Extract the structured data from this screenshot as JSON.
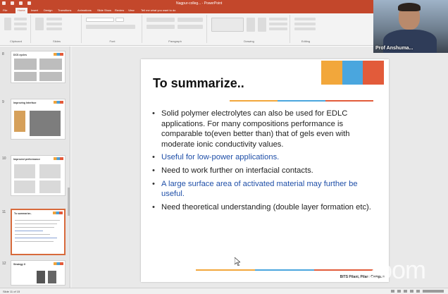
{
  "window": {
    "title": "Nagpur-colleg...  - PowerPoint"
  },
  "ribbon": {
    "tabs": [
      {
        "label": "File"
      },
      {
        "label": "Home"
      },
      {
        "label": "Insert"
      },
      {
        "label": "Design"
      },
      {
        "label": "Transitions"
      },
      {
        "label": "Animations"
      },
      {
        "label": "Slide Show"
      },
      {
        "label": "Review"
      },
      {
        "label": "View"
      },
      {
        "label": "Tell me what you want to do"
      }
    ],
    "active_tab": "Home",
    "groups": [
      {
        "label": "Clipboard"
      },
      {
        "label": "Slides"
      },
      {
        "label": "Font"
      },
      {
        "label": "Paragraph"
      },
      {
        "label": "Drawing"
      },
      {
        "label": "Editing"
      }
    ]
  },
  "thumbnails": [
    {
      "num": "8",
      "title": "DCS cycles",
      "selected": false
    },
    {
      "num": "9",
      "title": "Improving Interface",
      "selected": false
    },
    {
      "num": "10",
      "title": "Improved performance",
      "selected": false
    },
    {
      "num": "11",
      "title": "To summarize..",
      "selected": true
    },
    {
      "num": "12",
      "title": "Strategy II",
      "selected": false
    }
  ],
  "slide": {
    "title": "To summarize..",
    "bullets": [
      {
        "text": "Solid polymer electrolytes can also be used for EDLC applications. For many compositions performance is comparable to(even better than) that of gels even with moderate ionic conductivity values.",
        "style": "normal"
      },
      {
        "text": "Useful for low-power applications.",
        "style": "blue"
      },
      {
        "text": "Need to work further on interfacial contacts.",
        "style": "normal"
      },
      {
        "text": "A large surface area of activated material may further be useful.",
        "style": "blue"
      },
      {
        "text": "Need theoretical understanding (double layer formation etc).",
        "style": "normal"
      }
    ],
    "footer": "BITS Pilani, Pilani Campus",
    "accent_colors": [
      "#f2a73b",
      "#4aa6de",
      "#e25b3a"
    ]
  },
  "webcam": {
    "name": "Prof Anshuma..."
  },
  "watermark": "zoom",
  "statusbar": {
    "left": "Slide 11 of 15"
  }
}
